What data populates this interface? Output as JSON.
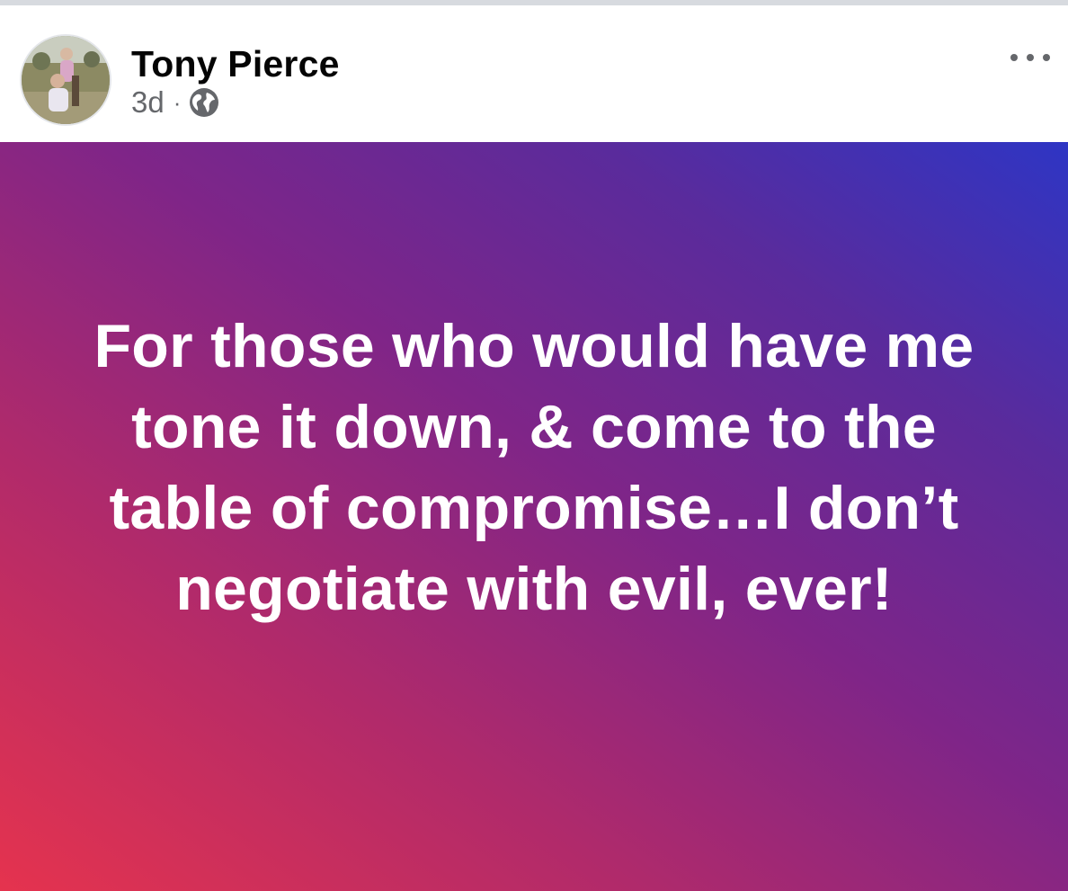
{
  "post": {
    "author_name": "Tony Pierce",
    "timestamp": "3d",
    "separator": "·",
    "audience_icon": "globe-icon",
    "more_icon": "more-options-icon",
    "text": "For those who would have me tone it down, & come to the table of compromise…I don’t negotiate with evil, ever!",
    "background_gradient": [
      "#e5334e",
      "#b02a6b",
      "#7f2588",
      "#5a2b9c",
      "#2e35c4"
    ],
    "text_color": "#ffffff"
  },
  "colors": {
    "name_text": "#050505",
    "meta_text": "#65676b",
    "divider": "#d7dadf"
  }
}
